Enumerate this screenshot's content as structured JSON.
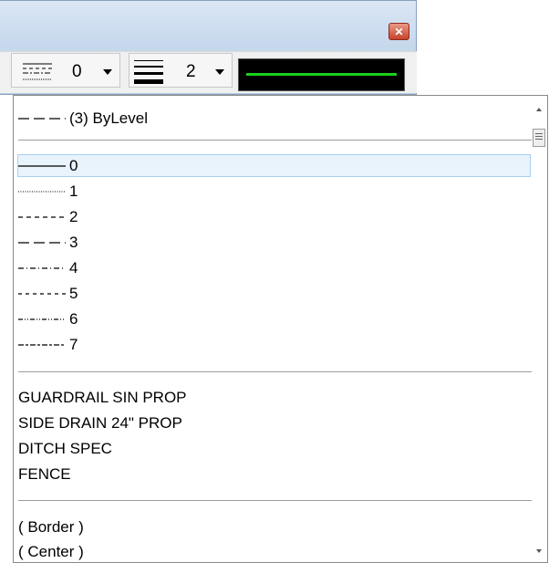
{
  "toolbar": {
    "close_icon": "close-icon",
    "style_value": "0",
    "weight_value": "2",
    "color": "#18d11a"
  },
  "dropdown": {
    "bylevel_label": "(3) ByLevel",
    "standard_styles": [
      {
        "label": "0",
        "selected": true
      },
      {
        "label": "1",
        "selected": false
      },
      {
        "label": "2",
        "selected": false
      },
      {
        "label": "3",
        "selected": false
      },
      {
        "label": "4",
        "selected": false
      },
      {
        "label": "5",
        "selected": false
      },
      {
        "label": "6",
        "selected": false
      },
      {
        "label": "7",
        "selected": false
      }
    ],
    "custom_styles": [
      "GUARDRAIL SIN PROP",
      "SIDE DRAIN 24\" PROP",
      "DITCH SPEC",
      "FENCE"
    ],
    "named_styles": [
      "( Border )",
      "( Center )"
    ]
  }
}
